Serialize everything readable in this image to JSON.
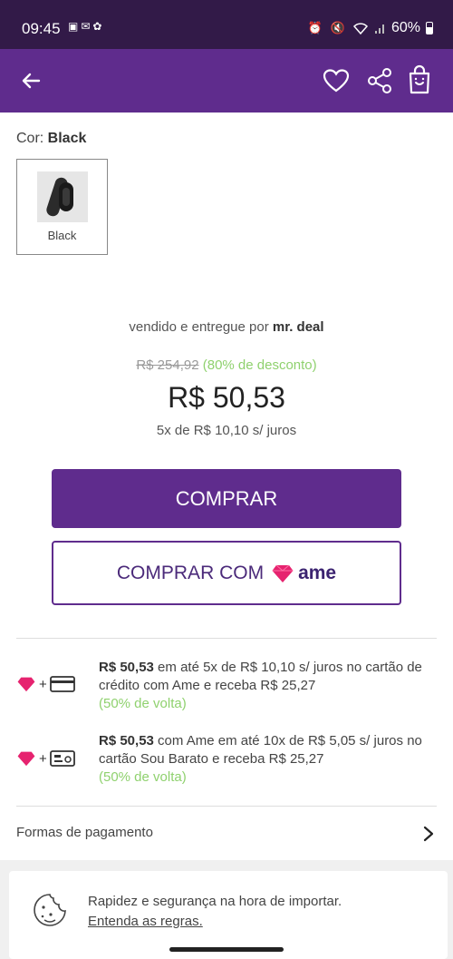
{
  "status_bar": {
    "time": "09:45",
    "battery": "60%",
    "left_icons": [
      "image-icon",
      "mail-icon",
      "game-icon"
    ],
    "right_icons": [
      "alarm-icon",
      "mute-icon",
      "wifi-icon",
      "signal-icon",
      "battery-icon"
    ]
  },
  "appbar": {
    "icons": [
      "back-arrow-icon",
      "heart-icon",
      "share-icon",
      "shopping-bag-icon"
    ],
    "color": "#5f2c8d"
  },
  "product": {
    "color_label": "Cor: ",
    "color_value": "Black",
    "swatch_name": "Black",
    "sold_by_prefix": "vendido e entregue por",
    "seller": "mr. deal",
    "old_price": "R$ 254,92",
    "discount": "(80% de desconto)",
    "price": "R$ 50,53",
    "installments": "5x de R$ 10,10 s/ juros"
  },
  "buttons": {
    "buy": "COMPRAR",
    "buy_with": "COMPRAR COM",
    "ame_logo_text": "ame"
  },
  "offers": [
    {
      "icons": [
        "ame-heart-icon",
        "plus",
        "credit-card-icon"
      ],
      "amount": "R$ 50,53",
      "text": " em até 5x de R$ 10,10 s/ juros no cartão de crédito  com Ame e receba R$ 25,27",
      "cashback": "(50% de volta)"
    },
    {
      "icons": [
        "ame-heart-icon",
        "plus",
        "sou-barato-card-icon"
      ],
      "amount": "R$ 50,53",
      "text": " com Ame em até 10x de R$ 5,05 s/ juros no cartão Sou Barato  e receba R$ 25,27",
      "cashback": "(50% de volta)"
    }
  ],
  "payment": {
    "label": "Formas de pagamento"
  },
  "import_info": {
    "text": "Rapidez e segurança na hora de importar.",
    "link": "Entenda as regras."
  },
  "colors": {
    "primary": "#5f2c8d",
    "status_bar": "#321a48",
    "green": "#8fd16e",
    "ame_pink": "#e6236f"
  }
}
